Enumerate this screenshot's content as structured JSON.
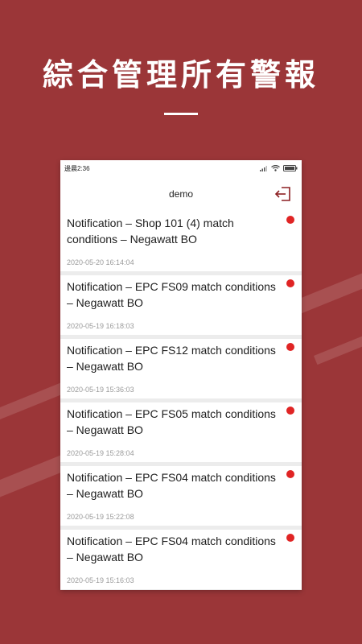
{
  "headline": "綜合管理所有警報",
  "status_bar": {
    "time": "邊晨2:36"
  },
  "app_bar": {
    "title": "demo",
    "exit_icon": "logout-icon"
  },
  "colors": {
    "background": "#9b3638",
    "unread_dot": "#e02424"
  },
  "notifications": [
    {
      "title": "Notification – Shop 101 (4) match conditions – Negawatt BO",
      "time": "2020-05-20 16:14:04",
      "unread": true
    },
    {
      "title": "Notification – EPC FS09 match conditions – Negawatt BO",
      "time": "2020-05-19 16:18:03",
      "unread": true
    },
    {
      "title": "Notification – EPC FS12 match conditions – Negawatt BO",
      "time": "2020-05-19 15:36:03",
      "unread": true
    },
    {
      "title": "Notification – EPC FS05 match conditions – Negawatt BO",
      "time": "2020-05-19 15:28:04",
      "unread": true
    },
    {
      "title": "Notification – EPC FS04 match conditions – Negawatt BO",
      "time": "2020-05-19 15:22:08",
      "unread": true
    },
    {
      "title": "Notification – EPC FS04 match conditions – Negawatt BO",
      "time": "2020-05-19 15:16:03",
      "unread": true
    }
  ]
}
